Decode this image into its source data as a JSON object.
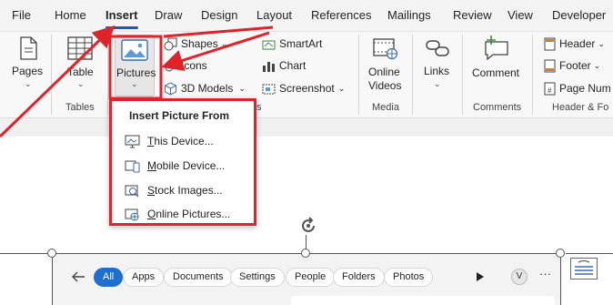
{
  "tabs": [
    "File",
    "Home",
    "Insert",
    "Draw",
    "Design",
    "Layout",
    "References",
    "Mailings",
    "Review",
    "View",
    "Developer"
  ],
  "active_tab": "Insert",
  "ribbon": {
    "pages_label": "Pages",
    "table_label": "Table",
    "tables_group": "Tables",
    "pictures_label": "Pictures",
    "shapes_label": "Shapes",
    "icons_label": "Icons",
    "models_label": "3D Models",
    "smartart_label": "SmartArt",
    "chart_label": "Chart",
    "screenshot_label": "Screenshot",
    "illustrations_group_tail": "s",
    "online_videos_line1": "Online",
    "online_videos_line2": "Videos",
    "media_group": "Media",
    "links_label": "Links",
    "comment_label": "Comment",
    "comments_group": "Comments",
    "header_label": "Header",
    "footer_label": "Footer",
    "page_number_label": "Page Num",
    "header_footer_group": "Header & Fo"
  },
  "dropdown": {
    "title": "Insert Picture From",
    "items": [
      {
        "pre": "",
        "u": "T",
        "post": "his Device..."
      },
      {
        "pre": "",
        "u": "M",
        "post": "obile Device..."
      },
      {
        "pre": "",
        "u": "S",
        "post": "tock Images..."
      },
      {
        "pre": "",
        "u": "O",
        "post": "nline Pictures..."
      }
    ]
  },
  "search_filters": [
    "All",
    "Apps",
    "Documents",
    "Settings",
    "People",
    "Folders",
    "Photos"
  ],
  "search_user_initial": "V",
  "colors": {
    "accent": "#185abd",
    "annotation_red": "#e0222a",
    "filter_active": "#1f6fd0"
  }
}
